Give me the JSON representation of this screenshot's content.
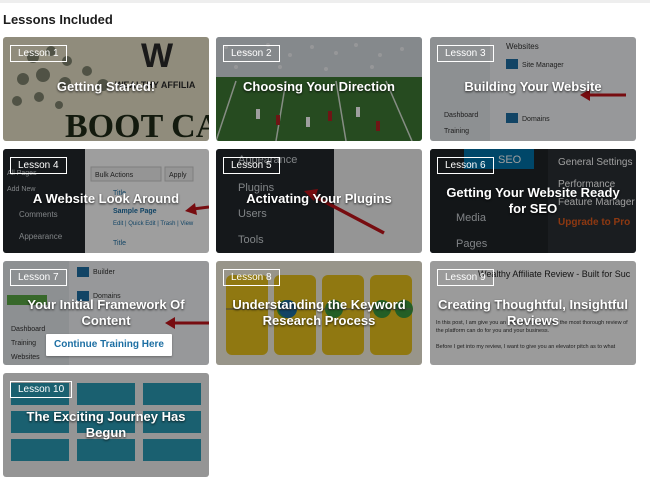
{
  "heading": "Lessons Included",
  "lessons": [
    {
      "badge": "Lesson 1",
      "title": "Getting Started!"
    },
    {
      "badge": "Lesson 2",
      "title": "Choosing Your Direction"
    },
    {
      "badge": "Lesson 3",
      "title": "Building Your Website"
    },
    {
      "badge": "Lesson 4",
      "title": "A Website Look Around"
    },
    {
      "badge": "Lesson 5",
      "title": "Activating Your Plugins"
    },
    {
      "badge": "Lesson 6",
      "title": "Getting Your Website Ready for SEO"
    },
    {
      "badge": "Lesson 7",
      "title": "Your Initial Framework Of Content"
    },
    {
      "badge": "Lesson 8",
      "title": "Understanding the Keyword Research Process"
    },
    {
      "badge": "Lesson 9",
      "title": "Creating Thoughtful, Insightful Reviews"
    },
    {
      "badge": "Lesson 10",
      "title": "The Exciting Journey Has Begun"
    }
  ],
  "continue_label": "Continue Training Here",
  "thumbs": {
    "boot": "BOOT CA",
    "wa": "WEALTHY AFFILIA",
    "websites": "Websites",
    "manager": "Site Manager",
    "domains": "Domains",
    "dashboard": "Dashboard",
    "training": "Training",
    "all_pages": "All Pages",
    "add_new": "Add New",
    "comments": "Comments",
    "appearance": "Appearance",
    "bulk_actions": "Bulk Actions",
    "apply": "Apply",
    "title_col": "Title",
    "sample_page": "Sample Page",
    "edit_row": "Edit | Quick Edit | Trash | View",
    "plugins": "Plugins",
    "users": "Users",
    "tools": "Tools",
    "media": "Media",
    "pages": "Pages",
    "general_settings": "General Settings",
    "performance": "Performance",
    "feature_manager": "Feature Manager",
    "upgrade_pro": "Upgrade to Pro",
    "seo": "SEO",
    "builder": "Builder",
    "review_title": "Wealthy Affiliate Review - Built for Suc",
    "review_p1": "In this post, I am give you an honest and hopefully the most thorough review of the platform can do for you and your business.",
    "review_p2": "Before I get into my review, I want to give you an elevator pitch as to what"
  }
}
